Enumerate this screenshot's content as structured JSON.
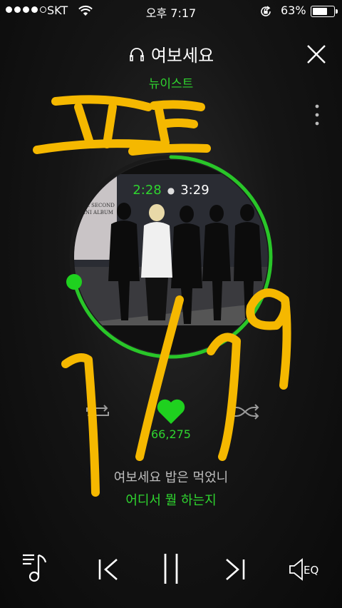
{
  "status_bar": {
    "carrier": "SKT",
    "time": "오후 7:17",
    "battery_percent": "63%",
    "battery_level": 0.63
  },
  "player": {
    "song_title": "여보세요",
    "artist": "뉴이스트",
    "elapsed": "2:28",
    "duration": "3:29",
    "progress": 0.71,
    "like_count": "66,275",
    "lyrics": {
      "current": "여보세요 밥은 먹었니",
      "next": "어디서 뭘 하는지"
    },
    "eq_label": "EQ"
  },
  "album_cover": {
    "text_lines": [
      "ST",
      "THE SECOND",
      "MINI ALBUM"
    ]
  },
  "colors": {
    "accent": "#2fd52f",
    "handwriting": "#f5b800"
  },
  "icons": [
    "close-icon",
    "more-vertical-icon",
    "repeat-icon",
    "heart-icon",
    "shuffle-icon",
    "playlist-music-icon",
    "previous-icon",
    "pause-icon",
    "next-icon",
    "speaker-eq-icon",
    "headphones-icon"
  ]
}
